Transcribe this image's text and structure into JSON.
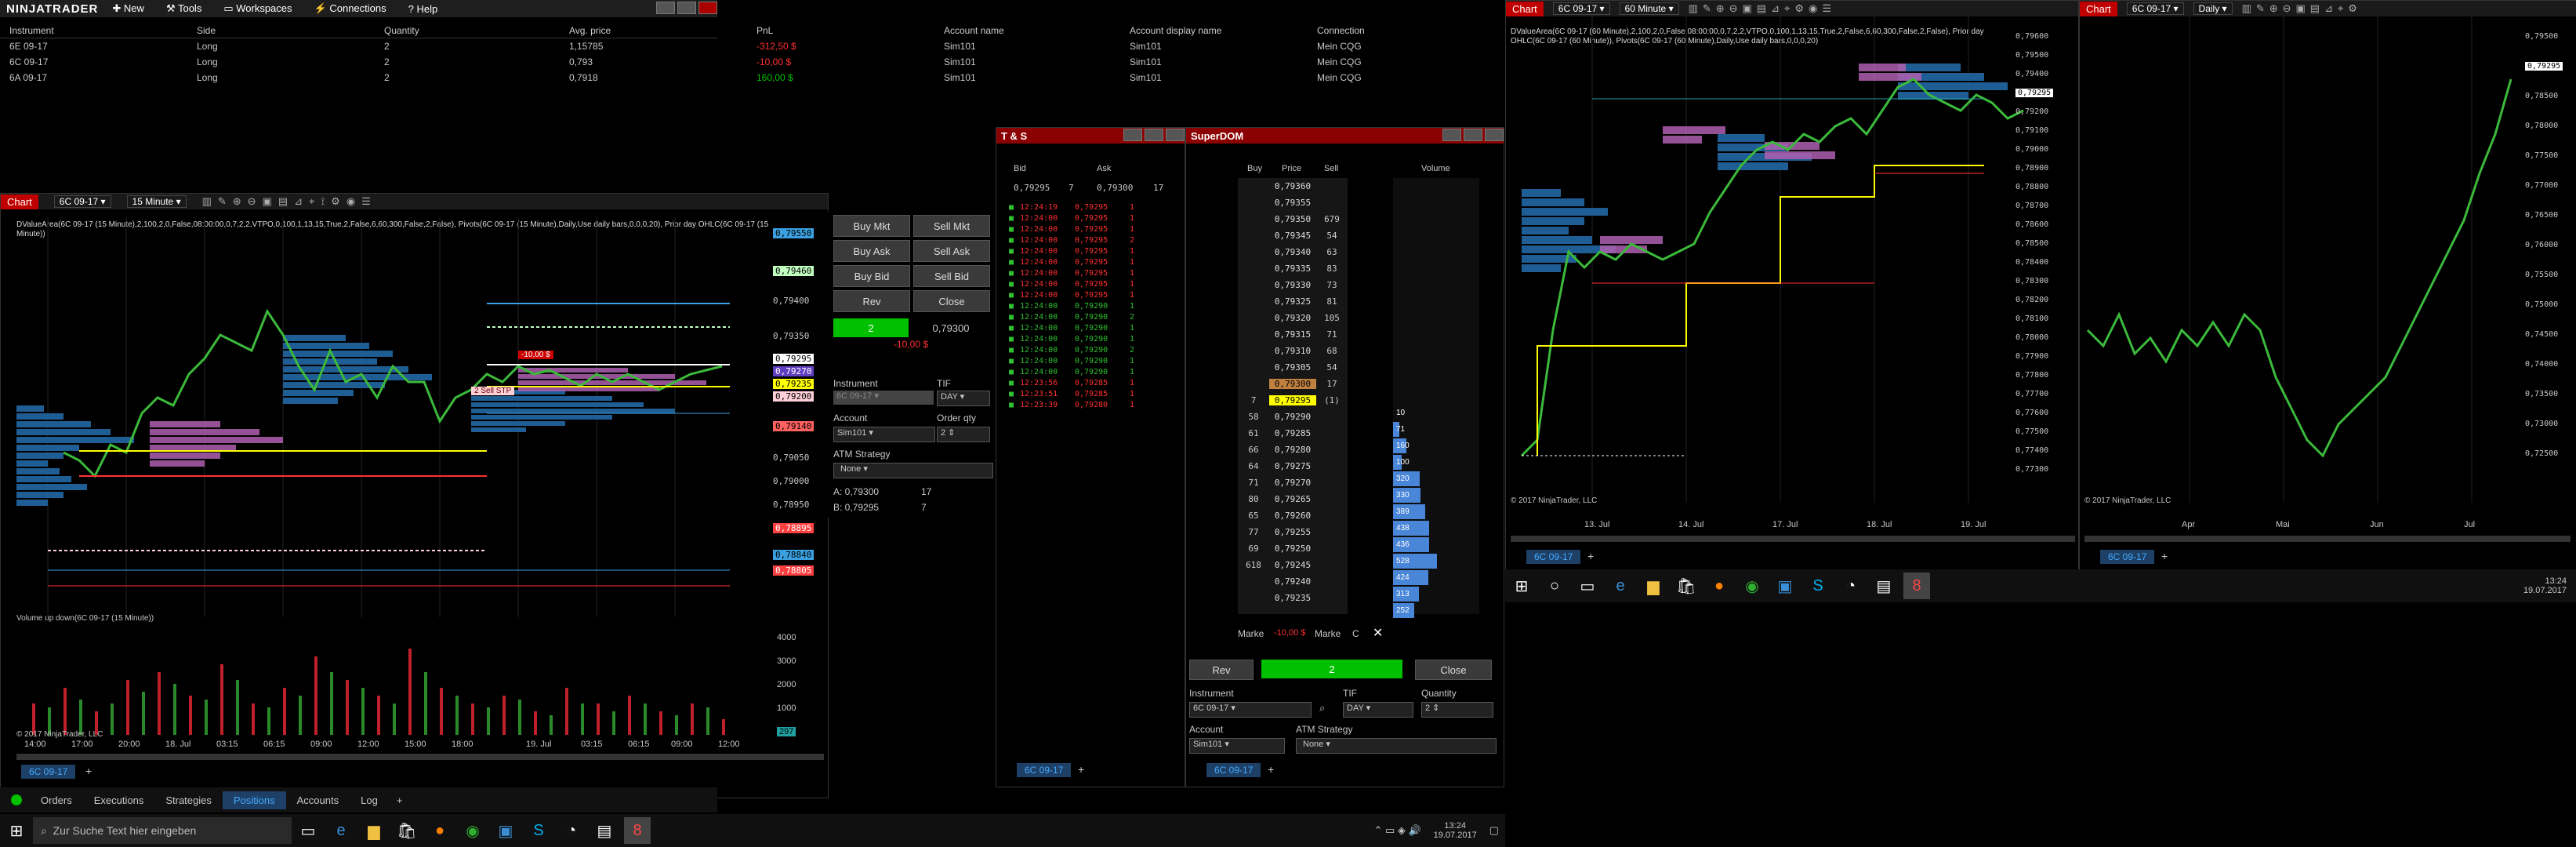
{
  "colors": {
    "accent": "#00c000",
    "red": "#ff3030",
    "blue": "#3a8fd6",
    "yellow": "#ffff00",
    "magenta": "#b040b0"
  },
  "menu": {
    "brand": "NINJATRADER",
    "items": [
      "New",
      "Tools",
      "Workspaces",
      "Connections",
      "Help"
    ]
  },
  "positions": {
    "headers": [
      "Instrument",
      "Side",
      "Quantity",
      "Avg. price",
      "PnL",
      "Account name",
      "Account display name",
      "Connection"
    ],
    "rows": [
      [
        "6E 09-17",
        "Long",
        "2",
        "1,15785",
        "-312,50 $",
        "Sim101",
        "Sim101",
        "Mein CQG"
      ],
      [
        "6C 09-17",
        "Long",
        "2",
        "0,793",
        "-10,00 $",
        "Sim101",
        "Sim101",
        "Mein CQG"
      ],
      [
        "6A 09-17",
        "Long",
        "2",
        "0,7918",
        "160,00 $",
        "Sim101",
        "Sim101",
        "Mein CQG"
      ]
    ]
  },
  "chart1": {
    "title": "Chart",
    "instrument": "6C 09-17",
    "interval": "15 Minute",
    "info": "DValueArea(6C 09-17 (15 Minute),2,100,2,0,False,08:00:00,0,7,2,2,VTPO,0,100,1,13,15,True,2,False,6,60,300,False,2,False), Pivots(6C 09-17 (15 Minute),Daily,Use daily bars,0,0,0,20), Prior day OHLC(6C 09-17 (15 Minute))",
    "price_labels": [
      "0,79550",
      "0,79460",
      "0,79400",
      "0,79350",
      "0,79295",
      "0,79270",
      "0,79235",
      "0,79200",
      "0,79140",
      "0,79050",
      "0,79000",
      "0,78950",
      "0,78895",
      "0,78840",
      "0,78805"
    ],
    "order_label": "-10,00 $",
    "stop_label": "2 Sell STP",
    "time_labels": [
      "14:00",
      "17:00",
      "20:00",
      "18. Jul",
      "03:15",
      "06:15",
      "09:00",
      "12:00",
      "15:00",
      "18:00",
      "19. Jul",
      "03:15",
      "06:15",
      "09:00",
      "12:00"
    ],
    "volume_title": "Volume up down(6C 09-17 (15 Minute))",
    "volume_ticks": [
      "4000",
      "3000",
      "2000",
      "1000",
      "297"
    ],
    "copyright": "© 2017 NinjaTrader, LLC",
    "tab": "6C 09-17"
  },
  "chart_trader": {
    "buy_mkt": "Buy Mkt",
    "sell_mkt": "Sell Mkt",
    "buy_ask": "Buy Ask",
    "sell_ask": "Sell Ask",
    "buy_bid": "Buy Bid",
    "sell_bid": "Sell Bid",
    "rev": "Rev",
    "close": "Close",
    "position_qty": "2",
    "price": "0,79300",
    "pnl": "-10,00 $",
    "instrument_label": "Instrument",
    "instrument": "6C 09-17",
    "tif_label": "TIF",
    "tif": "DAY",
    "account_label": "Account",
    "account": "Sim101",
    "order_qty_label": "Order qty",
    "order_qty": "2",
    "atm_label": "ATM Strategy",
    "atm": "None",
    "ask_line": "A: 0,79300",
    "ask_size": "17",
    "bid_line": "B: 0,79295",
    "bid_size": "7"
  },
  "ts": {
    "title": "T & S",
    "bid_label": "Bid",
    "ask_label": "Ask",
    "bid": "0,79295",
    "bid_size": "7",
    "ask": "0,79300",
    "ask_size": "17",
    "rows": [
      [
        "12:24:19",
        "0,79295",
        "1"
      ],
      [
        "12:24:00",
        "0,79295",
        "1"
      ],
      [
        "12:24:00",
        "0,79295",
        "1"
      ],
      [
        "12:24:00",
        "0,79295",
        "2"
      ],
      [
        "12:24:00",
        "0,79295",
        "1"
      ],
      [
        "12:24:00",
        "0,79295",
        "1"
      ],
      [
        "12:24:00",
        "0,79295",
        "1"
      ],
      [
        "12:24:00",
        "0,79295",
        "1"
      ],
      [
        "12:24:00",
        "0,79295",
        "1"
      ],
      [
        "12:24:00",
        "0,79290",
        "1"
      ],
      [
        "12:24:00",
        "0,79290",
        "2"
      ],
      [
        "12:24:00",
        "0,79290",
        "1"
      ],
      [
        "12:24:00",
        "0,79290",
        "1"
      ],
      [
        "12:24:00",
        "0,79290",
        "2"
      ],
      [
        "12:24:00",
        "0,79290",
        "1"
      ],
      [
        "12:24:00",
        "0,79290",
        "1"
      ],
      [
        "12:23:56",
        "0,79285",
        "1"
      ],
      [
        "12:23:51",
        "0,79285",
        "1"
      ],
      [
        "12:23:39",
        "0,79280",
        "1"
      ]
    ],
    "tab": "6C 09-17"
  },
  "superdom": {
    "title": "SuperDOM",
    "buy_label": "Buy",
    "price_label": "Price",
    "sell_label": "Sell",
    "volume_label": "Volume",
    "rows": [
      [
        "",
        "0,79360",
        ""
      ],
      [
        "",
        "0,79355",
        ""
      ],
      [
        "",
        "0,79350",
        "679"
      ],
      [
        "",
        "0,79345",
        "54"
      ],
      [
        "",
        "0,79340",
        "63"
      ],
      [
        "",
        "0,79335",
        "83"
      ],
      [
        "",
        "0,79330",
        "73"
      ],
      [
        "",
        "0,79325",
        "81"
      ],
      [
        "",
        "0,79320",
        "105"
      ],
      [
        "",
        "0,79315",
        "71"
      ],
      [
        "",
        "0,79310",
        "68"
      ],
      [
        "",
        "0,79305",
        "54"
      ],
      [
        "",
        "0,79300",
        "17"
      ],
      [
        "7",
        "0,79295",
        "(1)"
      ],
      [
        "58",
        "0,79290",
        ""
      ],
      [
        "61",
        "0,79285",
        ""
      ],
      [
        "66",
        "0,79280",
        ""
      ],
      [
        "64",
        "0,79275",
        ""
      ],
      [
        "71",
        "0,79270",
        ""
      ],
      [
        "80",
        "0,79265",
        ""
      ],
      [
        "65",
        "0,79260",
        ""
      ],
      [
        "77",
        "0,79255",
        ""
      ],
      [
        "69",
        "0,79250",
        ""
      ],
      [
        "618",
        "0,79245",
        ""
      ],
      [
        "",
        "0,79240",
        ""
      ],
      [
        "",
        "0,79235",
        ""
      ]
    ],
    "volumes": [
      "10",
      "71",
      "160",
      "100",
      "320",
      "330",
      "389",
      "438",
      "436",
      "528",
      "424",
      "313",
      "252"
    ],
    "market_left": "Marke",
    "market_pnl": "-10,00 $",
    "market_right": "Marke",
    "c_label": "C",
    "rev": "Rev",
    "qty": "2",
    "close": "Close",
    "instrument_label": "Instrument",
    "instrument": "6C 09-17",
    "tif_label": "TIF",
    "tif": "DAY",
    "quantity_label": "Quantity",
    "quantity": "2",
    "account_label": "Account",
    "account": "Sim101",
    "atm_label": "ATM Strategy",
    "atm": "None",
    "tab": "6C 09-17"
  },
  "chart2": {
    "title": "Chart",
    "instrument": "6C 09-17",
    "interval": "60 Minute",
    "info": "DValueArea(6C 09-17 (60 Minute),2,100,2,0,False,08:00:00,0,7,2,2,VTPO,0,100,1,13,15,True,2,False,6,60,300,False,2,False), Prior day OHLC(6C 09-17 (60 Minute)), Pivots(6C 09-17 (60 Minute),Daily,Use daily bars,0,0,0,20)",
    "price_labels": [
      "0,79600",
      "0,79500",
      "0,79400",
      "0,79295",
      "0,79200",
      "0,79100",
      "0,79000",
      "0,78900",
      "0,78800",
      "0,78700",
      "0,78600",
      "0,78500",
      "0,78400",
      "0,78300",
      "0,78200",
      "0,78100",
      "0,78000",
      "0,77900",
      "0,77800",
      "0,77700",
      "0,77600",
      "0,77500",
      "0,77400",
      "0,77300"
    ],
    "time_labels": [
      "13. Jul",
      "14. Jul",
      "17. Jul",
      "18. Jul",
      "19. Jul"
    ],
    "copyright": "© 2017 NinjaTrader, LLC",
    "tab": "6C 09-17"
  },
  "chart3": {
    "title": "Chart",
    "instrument": "6C 09-17",
    "interval": "Daily",
    "price_labels": [
      "0,79500",
      "0,79295",
      "0,78500",
      "0,78000",
      "0,77500",
      "0,77000",
      "0,76500",
      "0,76000",
      "0,75500",
      "0,75000",
      "0,74500",
      "0,74000",
      "0,73500",
      "0,73000",
      "0,72500"
    ],
    "time_labels": [
      "Apr",
      "Mai",
      "Jun",
      "Jul"
    ],
    "copyright": "© 2017 NinjaTrader, LLC",
    "tab": "6C 09-17"
  },
  "bottom_tabs": [
    "Orders",
    "Executions",
    "Strategies",
    "Positions",
    "Accounts",
    "Log"
  ],
  "taskbar": {
    "search_placeholder": "Zur Suche Text hier eingeben",
    "time": "13:24",
    "date": "19.07.2017"
  },
  "taskbar2": {
    "time": "13:24",
    "date": "19.07.2017"
  }
}
